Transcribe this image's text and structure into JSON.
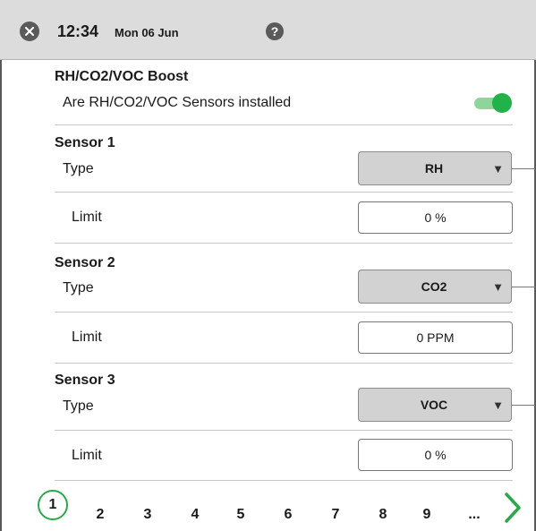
{
  "status_bar": {
    "time": "12:34",
    "date": "Mon 06 Jun",
    "help_label": "?"
  },
  "boost": {
    "title": "RH/CO2/VOC Boost",
    "question": "Are RH/CO2/VOC Sensors installed",
    "enabled": true
  },
  "sensors": [
    {
      "title": "Sensor 1",
      "type_label": "Type",
      "type_value": "RH",
      "limit_label": "Limit",
      "limit_value": "0 %"
    },
    {
      "title": "Sensor 2",
      "type_label": "Type",
      "type_value": "CO2",
      "limit_label": "Limit",
      "limit_value": "0 PPM"
    },
    {
      "title": "Sensor 3",
      "type_label": "Type",
      "type_value": "VOC",
      "limit_label": "Limit",
      "limit_value": "0 %"
    }
  ],
  "pagination": {
    "current": "1",
    "pages": [
      "2",
      "3",
      "4",
      "5",
      "6",
      "7",
      "8",
      "9"
    ],
    "ellipsis": "..."
  },
  "colors": {
    "accent_green": "#21b34a",
    "topbar": "#dcdcdc",
    "select_bg": "#d2d2d2"
  },
  "icons": {
    "close": "close-icon",
    "help": "help-icon",
    "dropdown": "chevron-down-icon",
    "next": "chevron-right-icon"
  }
}
